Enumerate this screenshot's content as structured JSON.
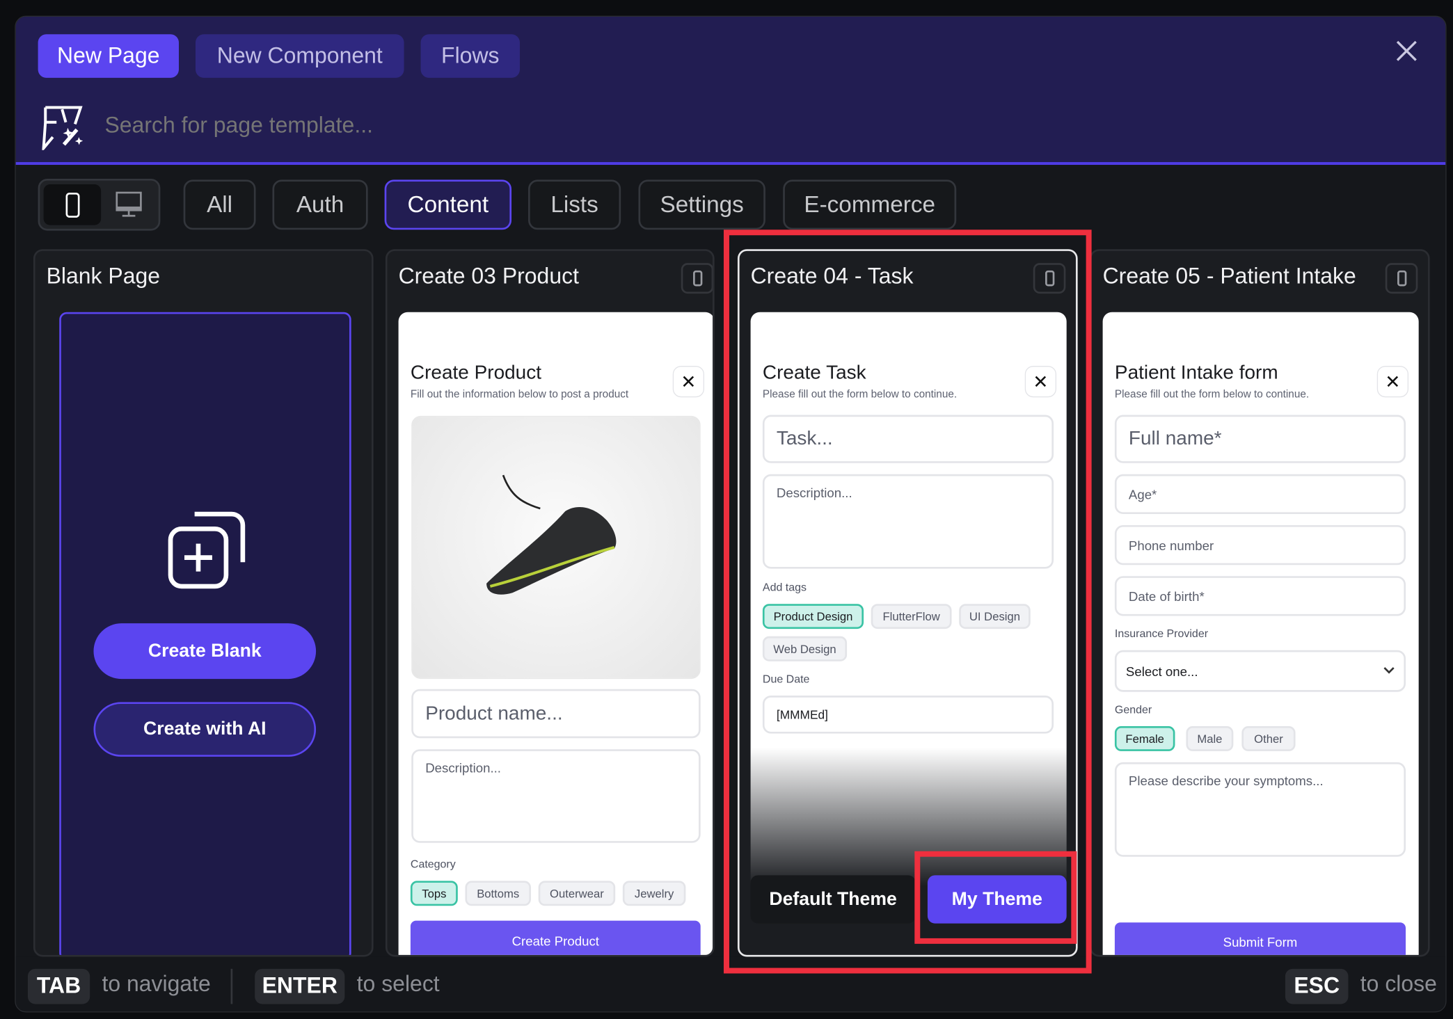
{
  "header": {
    "tabs": [
      {
        "label": "New Page",
        "active": true
      },
      {
        "label": "New Component",
        "active": false
      },
      {
        "label": "Flows",
        "active": false
      }
    ],
    "search_placeholder": "Search for page template...",
    "close_icon": "close-icon",
    "accent_color": "#5b45f0"
  },
  "filters": {
    "device_toggle": [
      {
        "icon": "phone-icon",
        "active": true
      },
      {
        "icon": "desktop-icon",
        "active": false
      }
    ],
    "categories": [
      {
        "label": "All"
      },
      {
        "label": "Auth"
      },
      {
        "label": "Content",
        "active": true
      },
      {
        "label": "Lists"
      },
      {
        "label": "Settings"
      },
      {
        "label": "E-commerce"
      }
    ]
  },
  "cards": {
    "blank": {
      "title": "Blank Page",
      "create_blank": "Create Blank",
      "create_ai": "Create with AI"
    },
    "product": {
      "title": "Create 03 Product",
      "form_title": "Create Product",
      "form_subtitle": "Fill out the information below to post a product",
      "name_placeholder": "Product name...",
      "desc_placeholder": "Description...",
      "category_label": "Category",
      "chips": [
        {
          "label": "Tops",
          "selected": true
        },
        {
          "label": "Bottoms"
        },
        {
          "label": "Outerwear"
        },
        {
          "label": "Jewelry"
        }
      ],
      "submit": "Create Product"
    },
    "task": {
      "title": "Create 04 - Task",
      "selected": true,
      "form_title": "Create Task",
      "form_subtitle": "Please fill out the form below to continue.",
      "task_placeholder": "Task...",
      "desc_placeholder": "Description...",
      "tags_label": "Add tags",
      "chips": [
        {
          "label": "Product Design",
          "selected": true
        },
        {
          "label": "FlutterFlow"
        },
        {
          "label": "UI Design"
        },
        {
          "label": "Web Design"
        }
      ],
      "due_label": "Due Date",
      "due_value": "[MMMEd]",
      "theme_default": "Default Theme",
      "theme_mine": "My Theme"
    },
    "patient": {
      "title": "Create 05 - Patient Intake",
      "form_title": "Patient Intake form",
      "form_subtitle": "Please fill out the form below to continue.",
      "fields": [
        "Full name*",
        "Age*",
        "Phone number",
        "Date of birth*"
      ],
      "insurance_label": "Insurance Provider",
      "insurance_value": "Select one...",
      "gender_label": "Gender",
      "chips": [
        {
          "label": "Female",
          "selected": true
        },
        {
          "label": "Male"
        },
        {
          "label": "Other"
        }
      ],
      "symptoms_placeholder": "Please describe your symptoms...",
      "submit": "Submit Form"
    }
  },
  "footer": {
    "tab_key": "TAB",
    "tab_text": "to navigate",
    "enter_key": "ENTER",
    "enter_text": "to select",
    "esc_key": "ESC",
    "esc_text": "to close"
  },
  "highlight_color": "#ef2f3e"
}
